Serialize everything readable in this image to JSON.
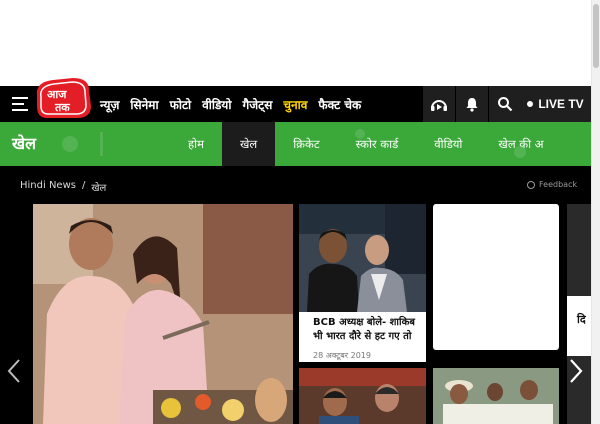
{
  "brand": {
    "logo_text": "आज तक",
    "accent": "#e41e26"
  },
  "topnav": {
    "items": [
      {
        "label": "न्यूज़",
        "active": false
      },
      {
        "label": "सिनेमा",
        "active": false
      },
      {
        "label": "फोटो",
        "active": false
      },
      {
        "label": "वीडियो",
        "active": false
      },
      {
        "label": "गैजेट्स",
        "active": false
      },
      {
        "label": "चुनाव",
        "active": true
      },
      {
        "label": "फैक्ट चेक",
        "active": false
      }
    ],
    "icons": [
      "audio-icon",
      "bell-icon",
      "search-icon"
    ],
    "live_tv": "LIVE TV"
  },
  "section": {
    "title": "खेल",
    "color": "#3ba83a",
    "tabs": [
      {
        "label": "होम",
        "active": false
      },
      {
        "label": "खेल",
        "active": true
      },
      {
        "label": "क्रिकेट",
        "active": false
      },
      {
        "label": "स्कोर कार्ड",
        "active": false
      },
      {
        "label": "वीडियो",
        "active": false
      },
      {
        "label": "खेल की अ",
        "active": false
      }
    ]
  },
  "breadcrumb": {
    "home": "Hindi News",
    "sep": "/",
    "current": "खेल"
  },
  "feedback": "Feedback",
  "story_card": {
    "headline": "BCB अध्यक्ष बोले- शाकिब भी भारत दौरे से हट गए तो",
    "date": "28 अक्टूबर 2019"
  },
  "partial_card_text": "दि"
}
